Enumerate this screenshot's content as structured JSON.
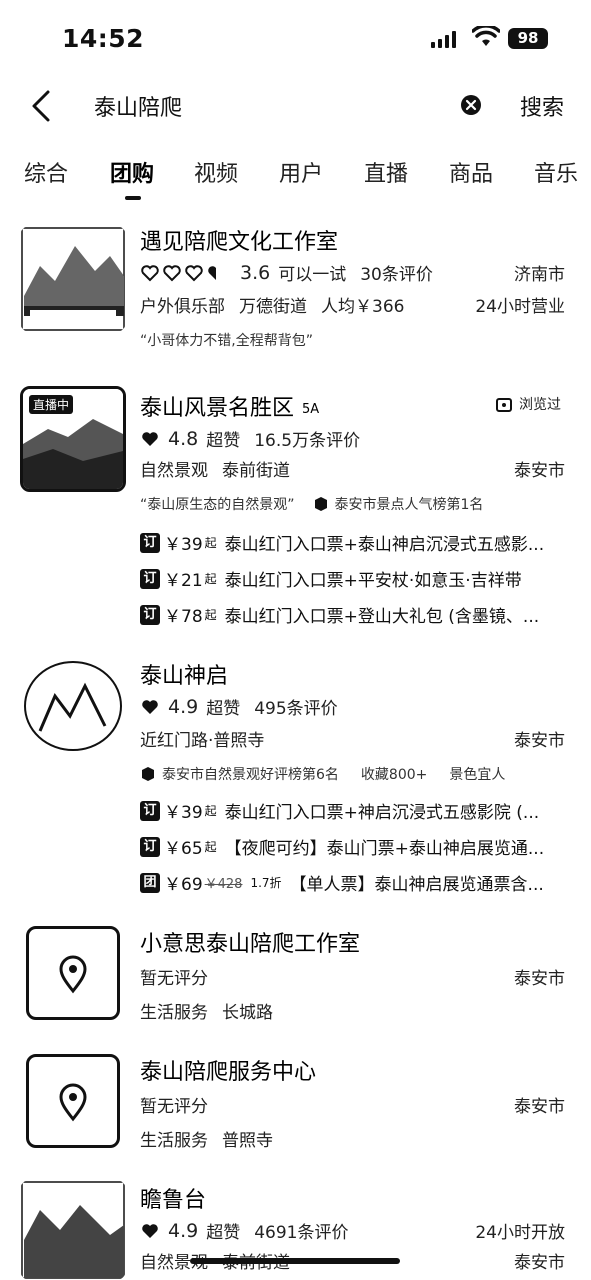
{
  "status_bar": {
    "time": "14:52",
    "battery": "98"
  },
  "search": {
    "query": "泰山陪爬",
    "button": "搜索"
  },
  "tabs": [
    "综合",
    "团购",
    "视频",
    "用户",
    "直播",
    "商品",
    "音乐"
  ],
  "results": [
    {
      "title": "遇见陪爬文化工作室",
      "rating": "3.6",
      "rating_text": "可以一试",
      "reviews": "30条评价",
      "city": "济南市",
      "category": "户外俱乐部",
      "street": "万德街道",
      "avg_price": "人均￥366",
      "hours": "24小时营业",
      "quote": "“小哥体力不错,全程帮背包”"
    },
    {
      "title": "泰山风景名胜区",
      "level": "5A",
      "seen": "浏览过",
      "thumb_label": "直播中",
      "rating": "4.8",
      "rating_text": "超赞",
      "reviews": "16.5万条评价",
      "category": "自然景观",
      "street": "泰前街道",
      "city": "泰安市",
      "quote": "“泰山原生态的自然景观”",
      "rank": "泰安市景点人气榜第1名",
      "deals": [
        {
          "badge": "订",
          "price": "￥39",
          "qi": "起",
          "text": "泰山红门入口票+泰山神启沉浸式五感影..."
        },
        {
          "badge": "订",
          "price": "￥21",
          "qi": "起",
          "text": "泰山红门入口票+平安杖·如意玉·吉祥带"
        },
        {
          "badge": "订",
          "price": "￥78",
          "qi": "起",
          "text": "泰山红门入口票+登山大礼包 (含墨镜、..."
        }
      ]
    },
    {
      "title": "泰山神启",
      "rating": "4.9",
      "rating_text": "超赞",
      "reviews": "495条评价",
      "location": "近红门路·普照寺",
      "city": "泰安市",
      "rank": "泰安市自然景观好评榜第6名",
      "favorites": "收藏800+",
      "tag": "景色宜人",
      "deals": [
        {
          "badge": "订",
          "price": "￥39",
          "qi": "起",
          "text": "泰山红门入口票+神启沉浸式五感影院 (..."
        },
        {
          "badge": "订",
          "price": "￥65",
          "qi": "起",
          "text": "【夜爬可约】泰山门票+泰山神启展览通..."
        },
        {
          "badge": "团",
          "price": "￥69",
          "orig": "￥428",
          "disc": "1.7折",
          "text": "【单人票】泰山神启展览通票含..."
        }
      ]
    },
    {
      "title": "小意思泰山陪爬工作室",
      "rating_none": "暂无评分",
      "city": "泰安市",
      "category": "生活服务",
      "street": "长城路"
    },
    {
      "title": "泰山陪爬服务中心",
      "rating_none": "暂无评分",
      "city": "泰安市",
      "category": "生活服务",
      "street": "普照寺"
    },
    {
      "title": "瞻鲁台",
      "rating": "4.9",
      "rating_text": "超赞",
      "reviews": "4691条评价",
      "hours": "24小时开放",
      "category": "自然景观",
      "street": "泰前街道",
      "city": "泰安市"
    }
  ],
  "colors": {
    "text": "#111111",
    "background": "#ffffff"
  }
}
